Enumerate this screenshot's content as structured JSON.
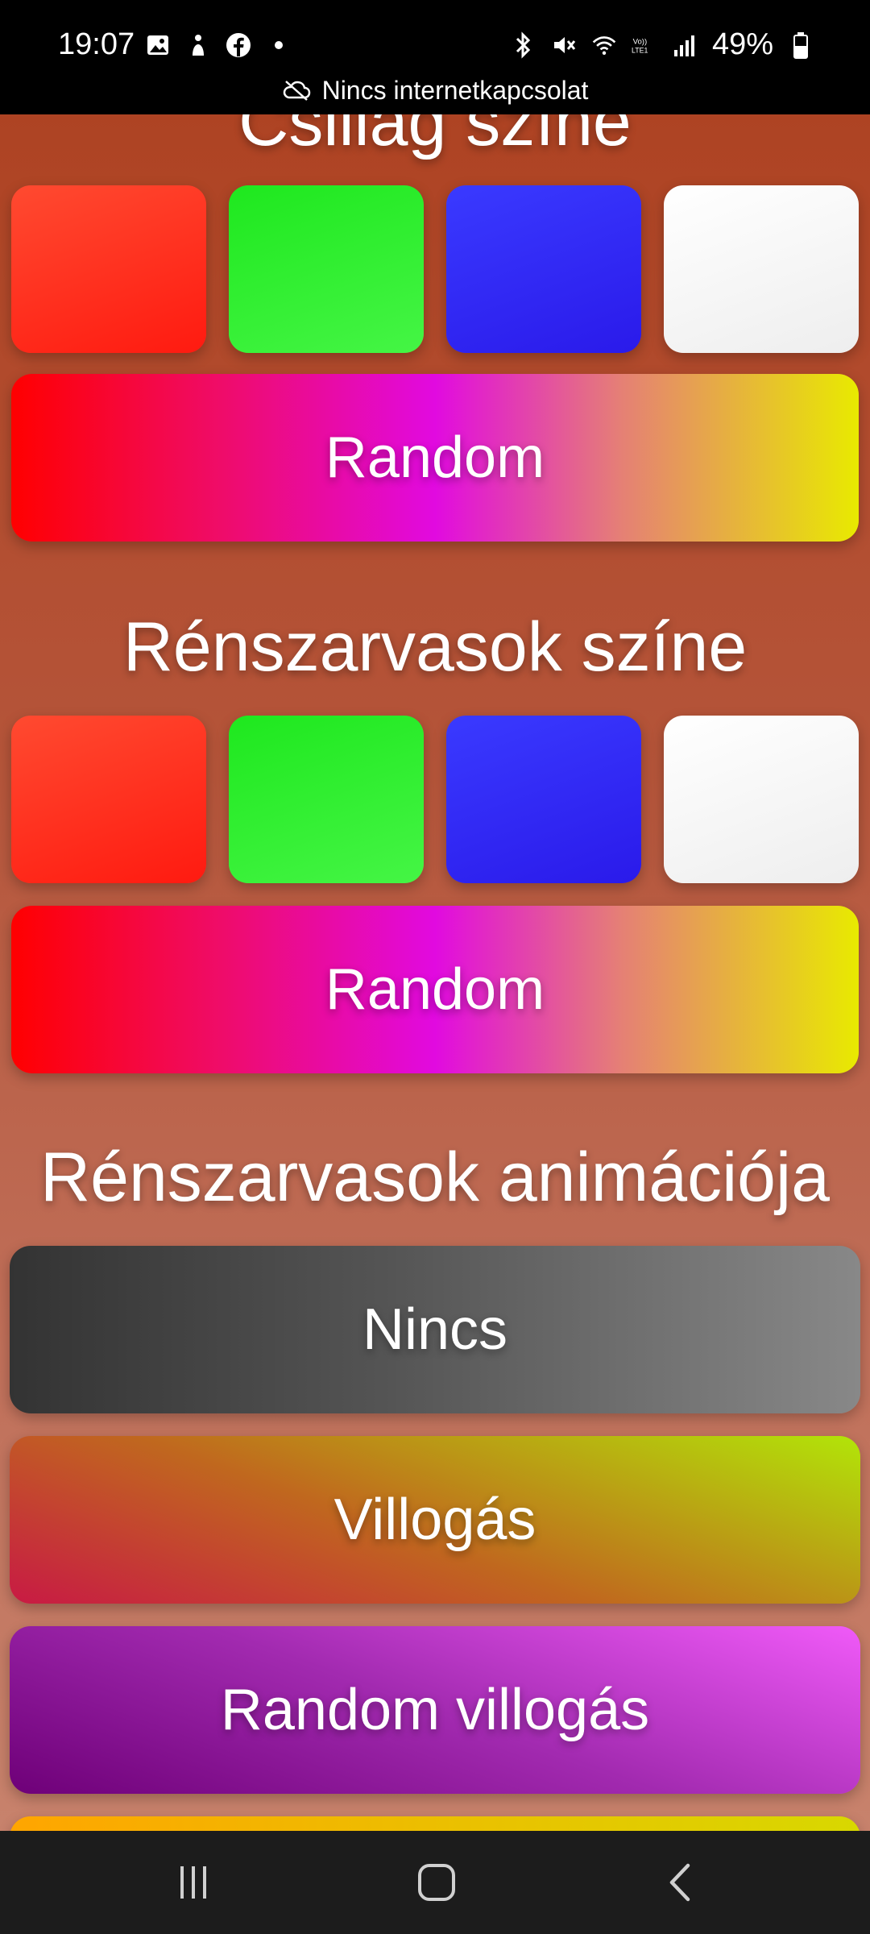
{
  "status": {
    "time": "19:07",
    "battery": "49%",
    "notice": "Nincs internetkapcsolat"
  },
  "sections": {
    "star_color": {
      "title": "Csillag színe",
      "random_label": "Random"
    },
    "reindeer_color": {
      "title": "Rénszarvasok színe",
      "random_label": "Random"
    },
    "reindeer_animation": {
      "title": "Rénszarvasok animációja",
      "options": [
        "Nincs",
        "Villogás",
        "Random villogás"
      ]
    }
  },
  "swatch_colors": [
    "#ff2a1a",
    "#2ee82e",
    "#2f2af5",
    "#ffffff"
  ],
  "icons": {
    "status_left": [
      "gallery-icon",
      "accessibility-icon",
      "facebook-icon",
      "dot-icon"
    ],
    "status_right": [
      "bluetooth-icon",
      "mute-icon",
      "wifi-icon",
      "volte-icon",
      "signal-icon",
      "battery-icon"
    ],
    "nav": [
      "recents-icon",
      "home-icon",
      "back-icon"
    ]
  }
}
